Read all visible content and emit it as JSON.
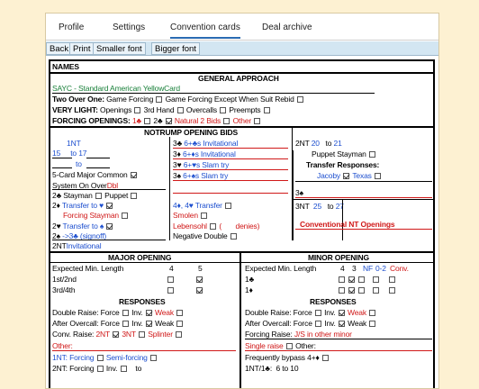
{
  "tabs": [
    "Profile",
    "Settings",
    "Convention cards",
    "Deal archive"
  ],
  "toolbar": [
    "Back",
    "Print",
    "Smaller font",
    "Bigger font"
  ],
  "card": {
    "names_label": "NAMES",
    "general": {
      "title": "GENERAL APPROACH",
      "system": "SAYC - Standard American YellowCard",
      "two_over_one": "Two Over One:",
      "game_forcing": "Game Forcing",
      "game_forcing_except": "Game Forcing Except When Suit Rebid",
      "very_light": "VERY LIGHT:",
      "openings": "Openings",
      "third_hand": "3rd Hand",
      "overcalls": "Overcalls",
      "preempts": "Preempts",
      "forcing_openings": "FORCING OPENINGS:",
      "one_club": "1♣",
      "two_club": "2♣",
      "natural_2_bids": "Natural 2 Bids",
      "other": "Other"
    },
    "notrump": {
      "title": "NOTRUMP OPENING BIDS",
      "one_nt": "1NT",
      "range_from": "15",
      "range_to_label": "to",
      "range_to": "17",
      "to_label": "to",
      "five_card_major": "5-Card Major Common",
      "system_on_over": "System On Over",
      "system_on_over_value": "Dbl",
      "stayman": "2♣  Stayman",
      "puppet": "Puppet",
      "two_d_label": "2♦",
      "two_d_transfer": "Transfer to ♥",
      "forcing_stayman": "Forcing Stayman",
      "two_h_label": "2♥",
      "two_h_transfer": "Transfer to ♠",
      "two_s_label": "2♠",
      "two_s_value": "->3♣ (signoff)",
      "two_nt_label": "2NT",
      "two_nt_value": "Invitational",
      "mid": [
        {
          "bid": "3♣",
          "text": "6+♣s Invitational"
        },
        {
          "bid": "3♦",
          "text": "6+♦s Invitational"
        },
        {
          "bid": "3♥",
          "text": "6+♥s Slam try"
        },
        {
          "bid": "3♠",
          "text": "6+♠s Slam try"
        }
      ],
      "four_transfer": "4♦, 4♥ Transfer",
      "smolen": "Smolen",
      "lebensohl": "Lebensohl",
      "denies": "denies)",
      "negative_double": "Negative Double",
      "two_nt_open": "2NT",
      "two_nt_from": "20",
      "two_nt_to": "21",
      "puppet_stayman": "Puppet Stayman",
      "transfer_responses": "Transfer Responses:",
      "jacoby": "Jacoby",
      "texas": "Texas",
      "three_s": "3♠",
      "three_nt": "3NT",
      "three_nt_from": "25",
      "three_nt_to": "27",
      "conventional_nt": "Conventional NT Openings"
    },
    "major": {
      "title": "MAJOR OPENING",
      "expected": "Expected Min. Length",
      "col_4": "4",
      "col_5": "5",
      "first_second": "1st/2nd",
      "third_fourth": "3rd/4th",
      "responses": "RESPONSES",
      "double_raise": "Double Raise: Force",
      "after_overcall": "After Overcall: Force",
      "inv": "Inv.",
      "weak": "Weak",
      "conv_raise": "Conv. Raise:",
      "two_nt": "2NT",
      "three_nt": "3NT",
      "splinter": "Splinter",
      "other": "Other:",
      "one_nt_forcing": "1NT: Forcing",
      "semi_forcing": "Semi-forcing",
      "two_nt_forcing": "2NT: Forcing",
      "to": "to"
    },
    "minor": {
      "title": "MINOR OPENING",
      "expected": "Expected Min. Length",
      "col_4": "4",
      "col_3": "3",
      "col_nf": "NF",
      "col_02": "0-2",
      "col_conv": "Conv.",
      "one_club": "1♣",
      "one_diamond": "1♦",
      "responses": "RESPONSES",
      "double_raise": "Double Raise: Force",
      "after_overcall": "After Overcall: Force",
      "inv": "Inv.",
      "weak": "Weak",
      "forcing_raise": "Forcing Raise:",
      "forcing_raise_value": "J/S in other minor",
      "single_raise": "Single raise",
      "other": "Other:",
      "frequently_bypass": "Frequently bypass 4+♦",
      "one_nt_over": "1NT/1♣:",
      "one_nt_range": "6 to 10"
    }
  },
  "colors": {
    "background": "#fdf1d2",
    "toolbar": "#d3e6f2",
    "red": "#d01818",
    "blue": "#1d4fcf",
    "green": "#19803a"
  }
}
